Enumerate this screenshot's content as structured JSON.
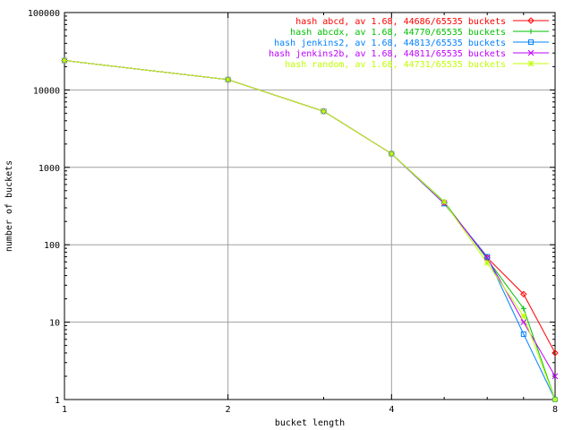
{
  "chart_data": {
    "type": "line",
    "xlabel": "bucket length",
    "ylabel": "number of buckets",
    "xscale": "log2",
    "yscale": "log10",
    "xlim": [
      1,
      8
    ],
    "ylim": [
      1,
      100000
    ],
    "xticks": [
      1,
      2,
      4,
      8
    ],
    "xtick_labels": [
      "1",
      "2",
      "4",
      "8"
    ],
    "yticks": [
      1,
      10,
      100,
      1000,
      10000,
      100000
    ],
    "ytick_labels": [
      "1",
      "10",
      "100",
      "1000",
      "10000",
      "100000"
    ],
    "grid": true,
    "legend_position": "top-right",
    "series": [
      {
        "name": "hash abcd, av 1.68, 44686/65535 buckets",
        "color": "#ff0000",
        "marker": "diamond",
        "x": [
          1,
          2,
          3,
          4,
          5,
          6,
          7,
          8
        ],
        "y": [
          24000,
          13600,
          5300,
          1500,
          350,
          68,
          23,
          4
        ]
      },
      {
        "name": "hash abcdx, av 1.68, 44770/65535 buckets",
        "color": "#00c000",
        "marker": "plus",
        "x": [
          1,
          2,
          3,
          4,
          5,
          6,
          7,
          8
        ],
        "y": [
          24000,
          13600,
          5300,
          1500,
          360,
          65,
          15,
          1
        ]
      },
      {
        "name": "hash jenkins2, av 1.68, 44813/65535 buckets",
        "color": "#0080ff",
        "marker": "square",
        "x": [
          1,
          2,
          3,
          4,
          5,
          6,
          7,
          8
        ],
        "y": [
          24000,
          13600,
          5300,
          1500,
          340,
          70,
          7,
          1
        ]
      },
      {
        "name": "hash jenkins2b, av 1.68, 44811/65535 buckets",
        "color": "#c000ff",
        "marker": "cross",
        "x": [
          1,
          2,
          3,
          4,
          5,
          6,
          7,
          8
        ],
        "y": [
          24000,
          13600,
          5300,
          1500,
          345,
          68,
          10,
          2
        ]
      },
      {
        "name": "hash random, av 1.68, 44731/65535 buckets",
        "color": "#c0ff00",
        "marker": "star",
        "x": [
          1,
          2,
          3,
          4,
          5,
          6,
          7,
          8
        ],
        "y": [
          24000,
          13600,
          5300,
          1500,
          355,
          58,
          12,
          1
        ]
      }
    ]
  }
}
